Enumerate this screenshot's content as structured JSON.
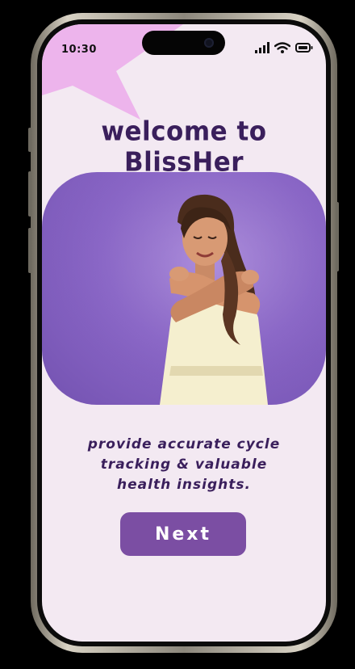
{
  "status_bar": {
    "time": "10:30",
    "icons": [
      "signal-icon",
      "wifi-icon",
      "battery-icon"
    ]
  },
  "onboarding": {
    "title": "welcome to BlissHer",
    "tagline_lines": [
      "provide accurate cycle",
      "tracking & valuable",
      "health insights."
    ],
    "next_label": "Next"
  },
  "colors": {
    "background": "#f3e9f2",
    "primary": "#7b4ea3",
    "text": "#3a1f5c",
    "accent_star": "#edb4ec",
    "hero_bg": "#8b67c8"
  }
}
